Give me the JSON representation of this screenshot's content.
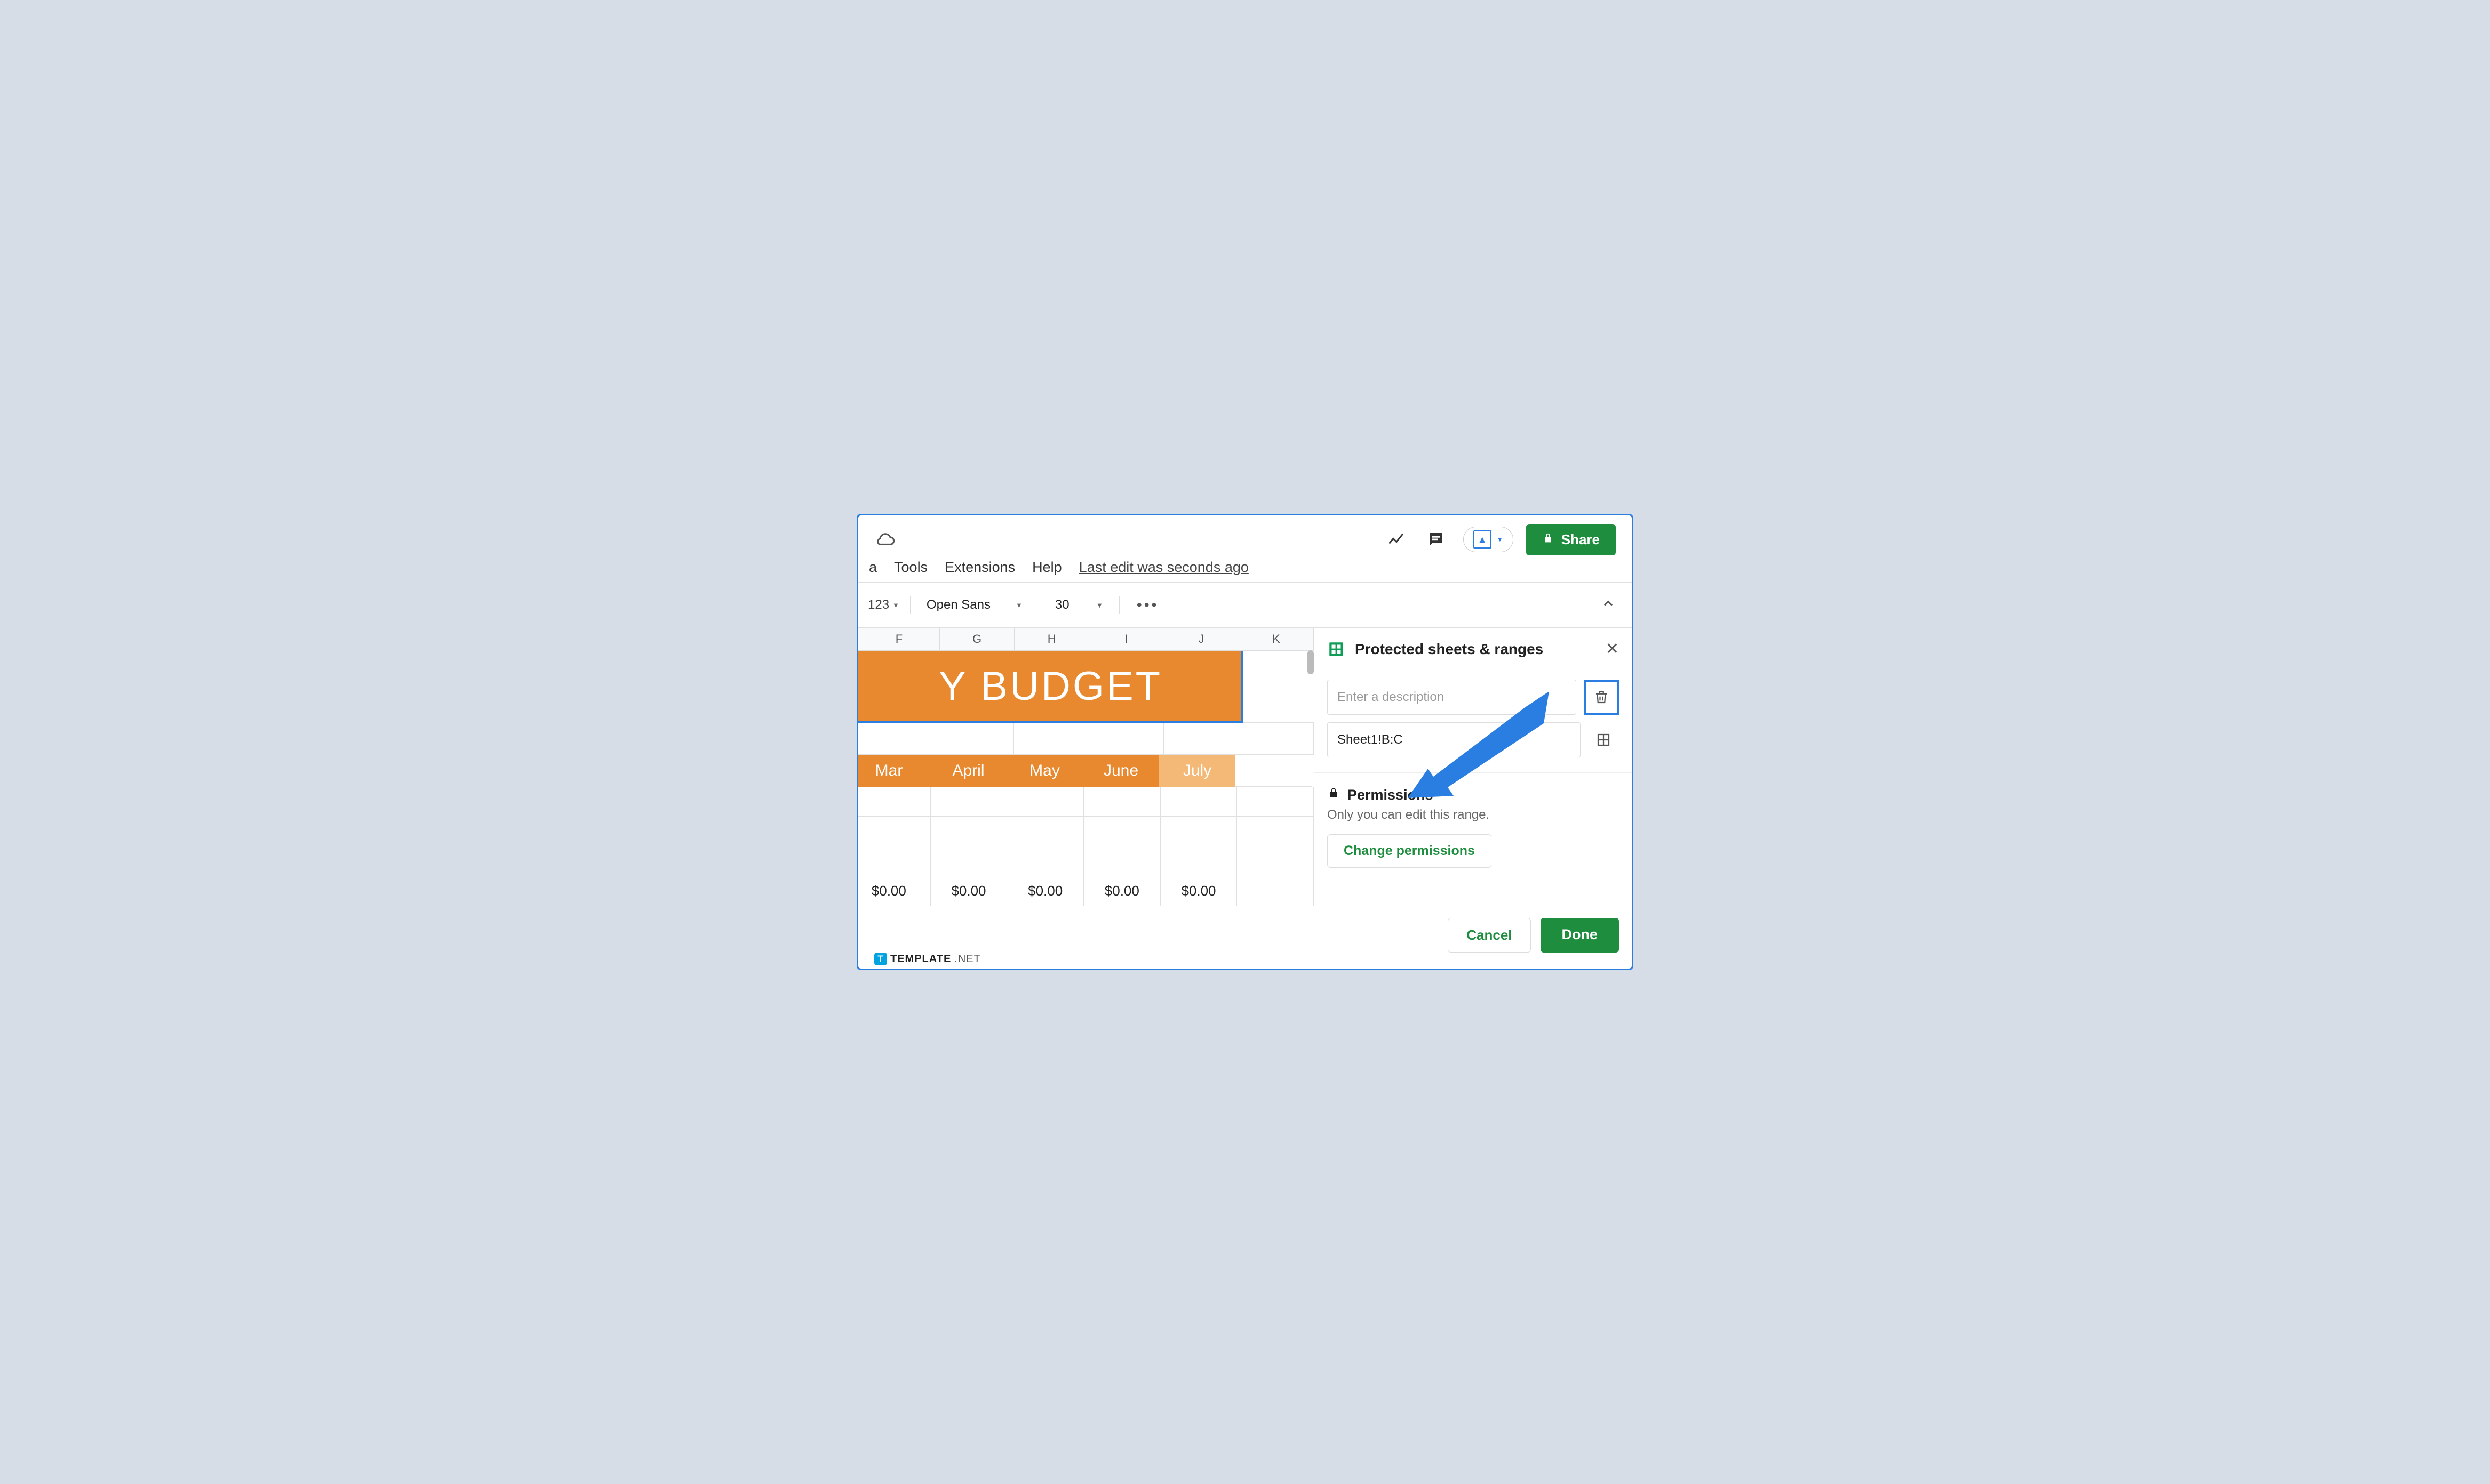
{
  "menubar": {
    "a_fragment": "a",
    "tools": "Tools",
    "extensions": "Extensions",
    "help": "Help",
    "last_edit": "Last edit was seconds ago"
  },
  "toolbar": {
    "format_frag": "123",
    "font": "Open Sans",
    "size": "30"
  },
  "share_label": "Share",
  "columns": [
    "F",
    "G",
    "H",
    "I",
    "J",
    "K"
  ],
  "banner": "Y  BUDGET",
  "months": [
    "Mar",
    "April",
    "May",
    "June",
    "July"
  ],
  "row_values": [
    "$0.00",
    "$0.00",
    "$0.00",
    "$0.00",
    "$0.00"
  ],
  "panel": {
    "title": "Protected sheets & ranges",
    "desc_placeholder": "Enter a description",
    "range": "Sheet1!B:C",
    "perm_title": "Permissions",
    "perm_sub": "Only you can edit this range.",
    "change": "Change permissions",
    "cancel": "Cancel",
    "done": "Done"
  },
  "watermark": {
    "brand": "TEMPLATE",
    "tld": ".NET"
  }
}
